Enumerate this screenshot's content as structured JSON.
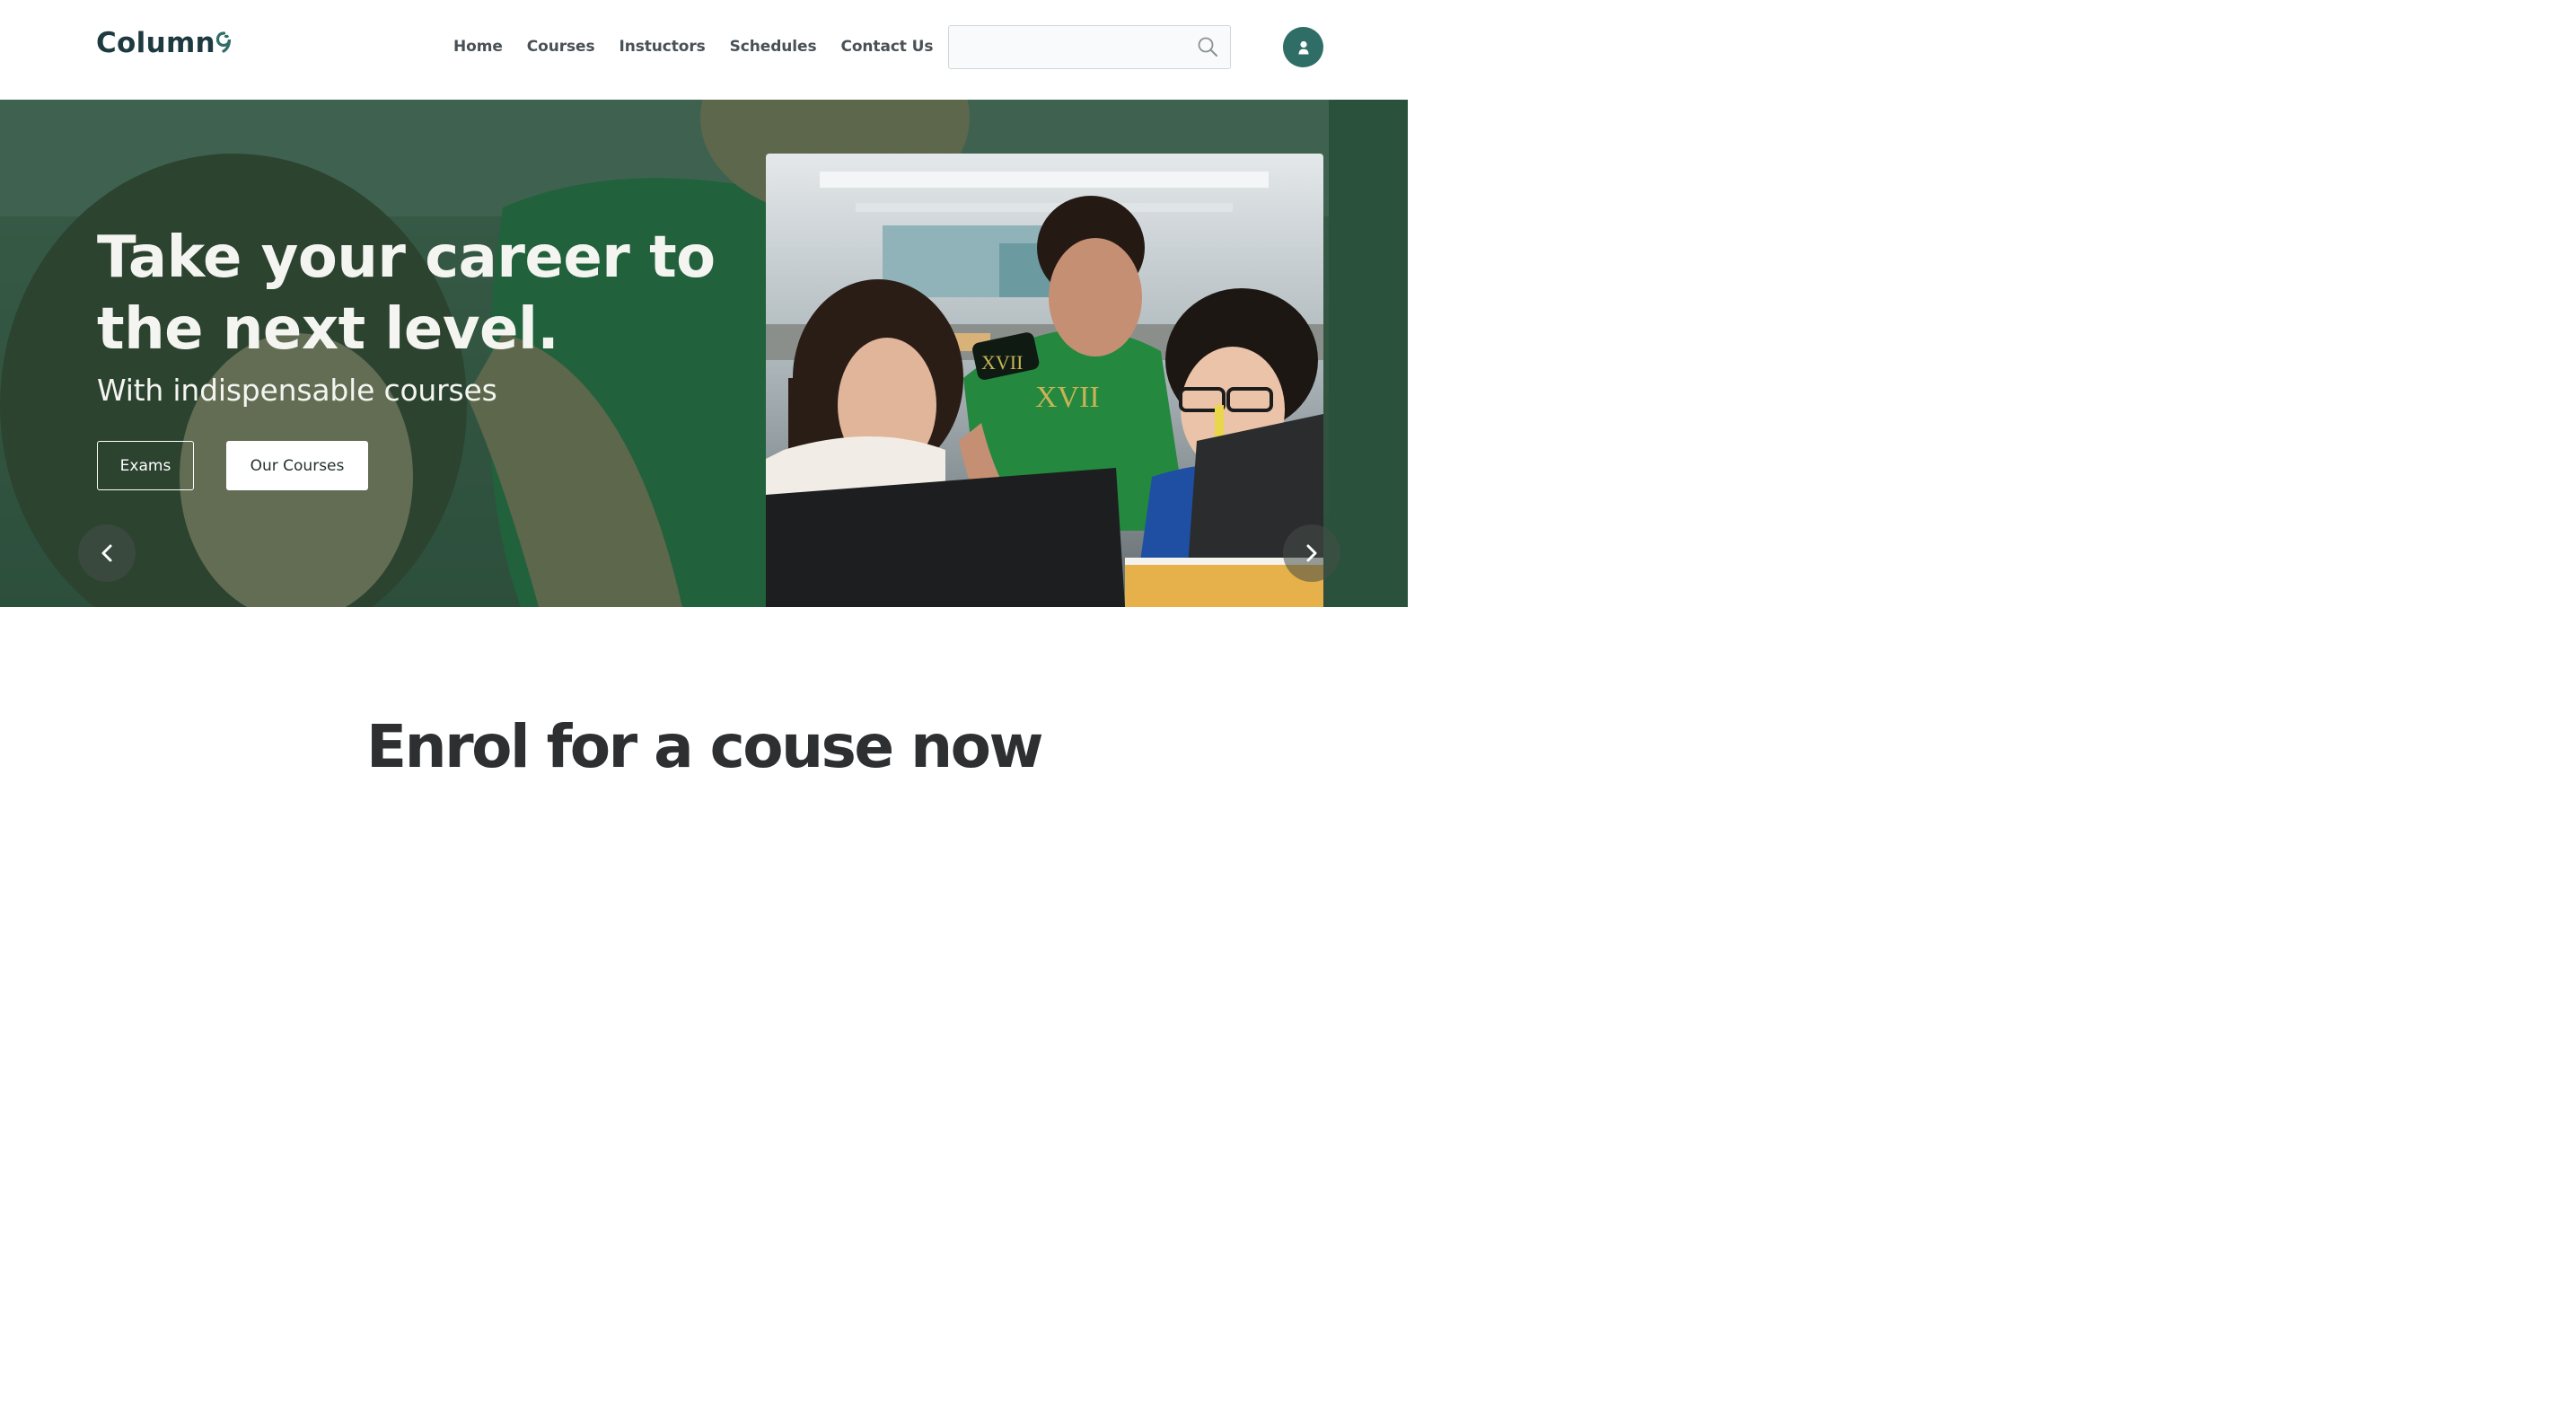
{
  "brand": {
    "name": "Column",
    "accent": "#2f6e67"
  },
  "nav": {
    "items": [
      {
        "label": "Home"
      },
      {
        "label": "Courses"
      },
      {
        "label": "Instuctors"
      },
      {
        "label": "Schedules"
      },
      {
        "label": "Contact Us"
      }
    ]
  },
  "search": {
    "value": "",
    "placeholder": "",
    "icon": "search-icon"
  },
  "user": {
    "icon": "user-icon"
  },
  "hero": {
    "title": "Take your career to the next level.",
    "subtitle": "With indispensable courses",
    "buttons": {
      "exams": "Exams",
      "courses": "Our Courses"
    },
    "prev_icon": "chevron-left-icon",
    "next_icon": "chevron-right-icon",
    "overlay_color": "#23523a"
  },
  "section": {
    "title": "Enrol for a couse now"
  }
}
